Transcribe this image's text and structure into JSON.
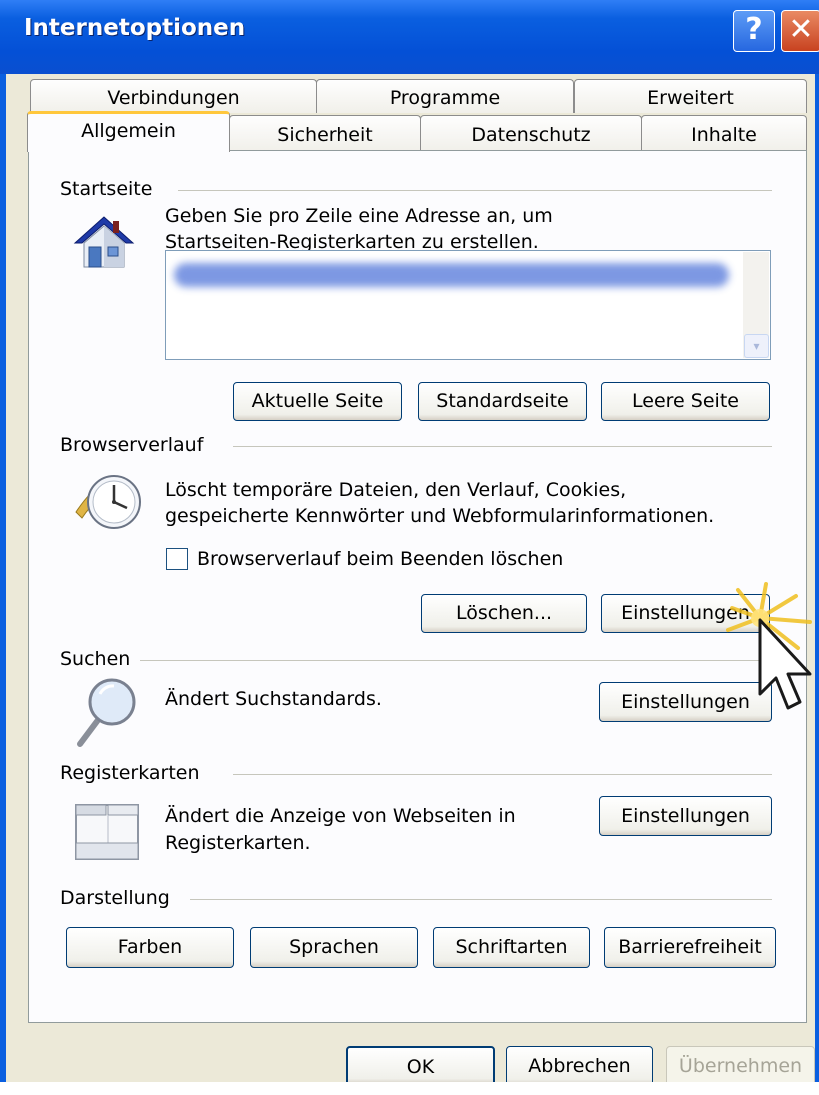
{
  "window": {
    "title": "Internetoptionen",
    "help_glyph": "?",
    "close_glyph": "✕"
  },
  "tabs": {
    "back": [
      "Verbindungen",
      "Programme",
      "Erweitert"
    ],
    "front": [
      "Allgemein",
      "Sicherheit",
      "Datenschutz",
      "Inhalte"
    ],
    "active": "Allgemein"
  },
  "startseite": {
    "label": "Startseite",
    "description_line1": "Geben Sie pro Zeile eine Adresse an, um",
    "description_line2": "Startseiten-Registerkarten zu erstellen.",
    "buttons": [
      "Aktuelle Seite",
      "Standardseite",
      "Leere Seite"
    ],
    "icon": "home-icon"
  },
  "browserverlauf": {
    "label": "Browserverlauf",
    "description_line1": "Löscht temporäre Dateien, den Verlauf, Cookies,",
    "description_line2": "gespeicherte Kennwörter und Webformularinformationen.",
    "checkbox_label": "Browserverlauf beim Beenden löschen",
    "checkbox_checked": false,
    "delete_button": "Löschen...",
    "settings_button": "Einstellungen",
    "icon": "history-clock-icon"
  },
  "suchen": {
    "label": "Suchen",
    "description": "Ändert Suchstandards.",
    "settings_button": "Einstellungen",
    "icon": "magnifier-icon"
  },
  "registerkarten": {
    "label": "Registerkarten",
    "description_line1": "Ändert die Anzeige von Webseiten in",
    "description_line2": "Registerkarten.",
    "settings_button": "Einstellungen",
    "icon": "tabs-window-icon"
  },
  "darstellung": {
    "label": "Darstellung",
    "buttons": [
      "Farben",
      "Sprachen",
      "Schriftarten",
      "Barrierefreiheit"
    ]
  },
  "footer": {
    "ok": "OK",
    "cancel": "Abbrechen",
    "apply": "Übernehmen"
  },
  "colors": {
    "titlebar": "#0a5fe0",
    "dialog_bg": "#ece9d8",
    "active_tab_accent": "#ffc73c",
    "button_border": "#003c74"
  }
}
